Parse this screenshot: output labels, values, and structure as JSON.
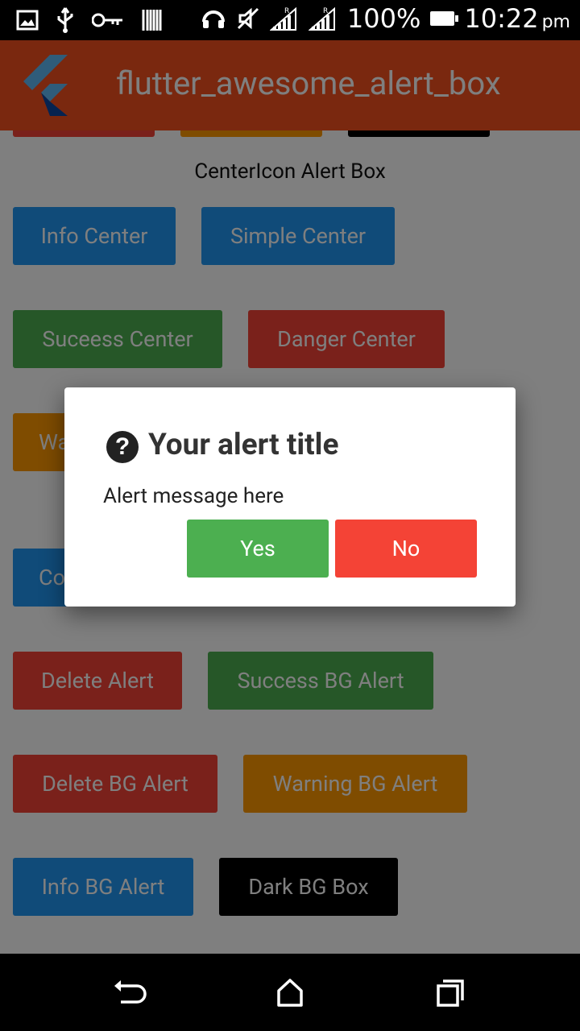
{
  "status_bar": {
    "battery": "100%",
    "time": "10:22",
    "time_suffix": "pm"
  },
  "app_bar": {
    "title": "flutter_awesome_alert_box"
  },
  "content": {
    "section_title": "CenterIcon Alert Box",
    "buttons": [
      {
        "label": "Info Center"
      },
      {
        "label": "Simple Center"
      },
      {
        "label": "Suceess Center"
      },
      {
        "label": "Danger Center"
      },
      {
        "label": "Wa"
      },
      {
        "label": "Co"
      },
      {
        "label": "Delete Alert"
      },
      {
        "label": "Success BG Alert"
      },
      {
        "label": "Delete BG Alert"
      },
      {
        "label": "Warning BG Alert"
      },
      {
        "label": "Info BG Alert"
      },
      {
        "label": "Dark BG Box"
      }
    ]
  },
  "dialog": {
    "icon": "question-circle-icon",
    "title": "Your alert title",
    "message": "Alert message here",
    "yes_label": "Yes",
    "no_label": "No"
  },
  "colors": {
    "app_bar": "#f4511e",
    "info": "#2196f3",
    "success": "#4caf50",
    "danger": "#f44336",
    "warning": "#ff9800",
    "dark": "#000000"
  }
}
